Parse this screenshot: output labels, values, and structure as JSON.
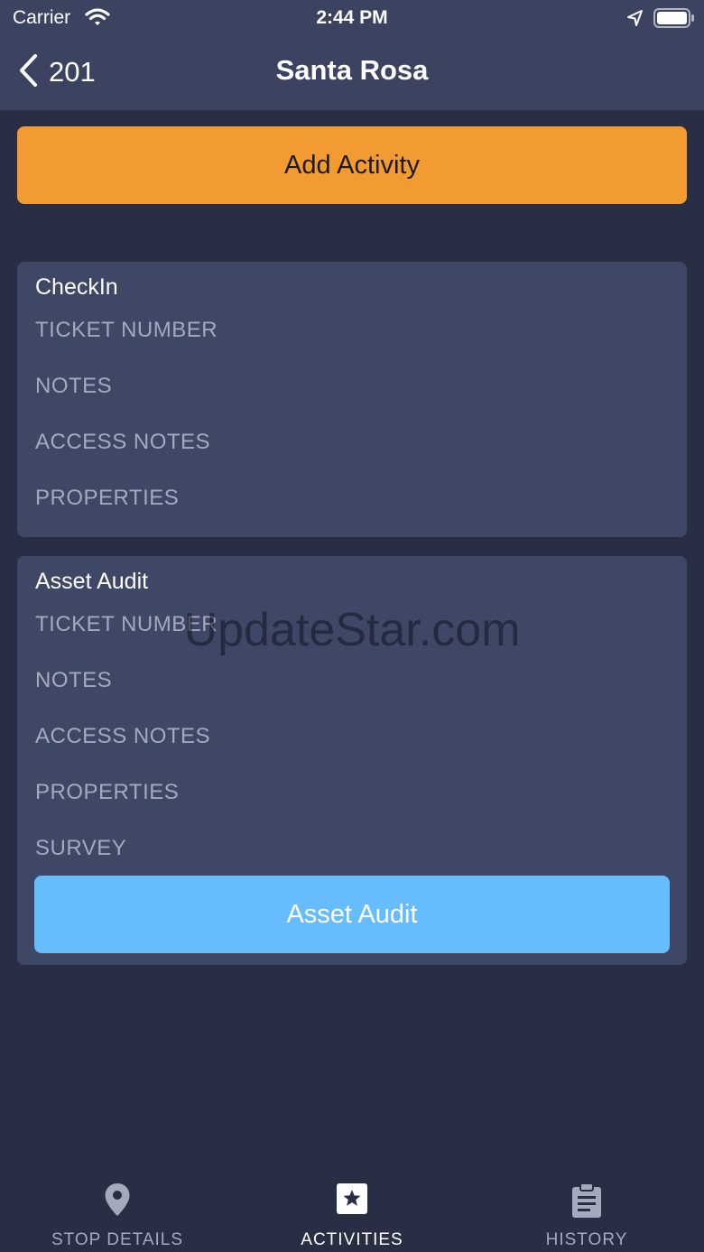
{
  "status_bar": {
    "carrier": "Carrier",
    "time": "2:44 PM"
  },
  "nav": {
    "back_label": "201",
    "title": "Santa Rosa"
  },
  "add_activity_label": "Add Activity",
  "activities": [
    {
      "title": "CheckIn",
      "fields": [
        "TICKET NUMBER",
        "NOTES",
        "ACCESS NOTES",
        "PROPERTIES"
      ]
    },
    {
      "title": "Asset Audit",
      "fields": [
        "TICKET NUMBER",
        "NOTES",
        "ACCESS NOTES",
        "PROPERTIES",
        "SURVEY"
      ],
      "action_label": "Asset Audit"
    }
  ],
  "watermark": "UpdateStar.com",
  "tabs": [
    {
      "label": "STOP DETAILS",
      "icon": "map-pin-icon",
      "active": false
    },
    {
      "label": "ACTIVITIES",
      "icon": "star-icon",
      "active": true
    },
    {
      "label": "HISTORY",
      "icon": "clipboard-icon",
      "active": false
    }
  ],
  "colors": {
    "background": "#2a2e45",
    "header": "#3c4361",
    "card": "#3f4766",
    "accent_orange": "#f29b32",
    "accent_blue": "#67bcfb",
    "muted_text": "#a4a9bd"
  }
}
